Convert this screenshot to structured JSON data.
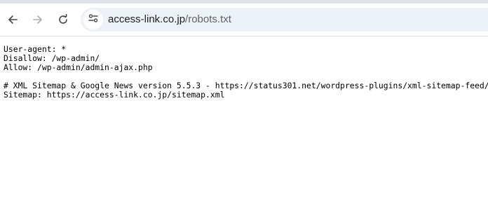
{
  "browser": {
    "back_icon": "arrow-left-icon",
    "forward_icon": "arrow-right-icon",
    "reload_icon": "reload-icon",
    "site_info_icon": "tune-icon",
    "url": {
      "host": "access-link.co.jp",
      "path": "/robots.txt"
    }
  },
  "document": {
    "lines": [
      "User-agent: *",
      "Disallow: /wp-admin/",
      "Allow: /wp-admin/admin-ajax.php",
      "",
      "# XML Sitemap & Google News version 5.5.3 - https://status301.net/wordpress-plugins/xml-sitemap-feed/",
      "Sitemap: https://access-link.co.jp/sitemap.xml"
    ]
  }
}
